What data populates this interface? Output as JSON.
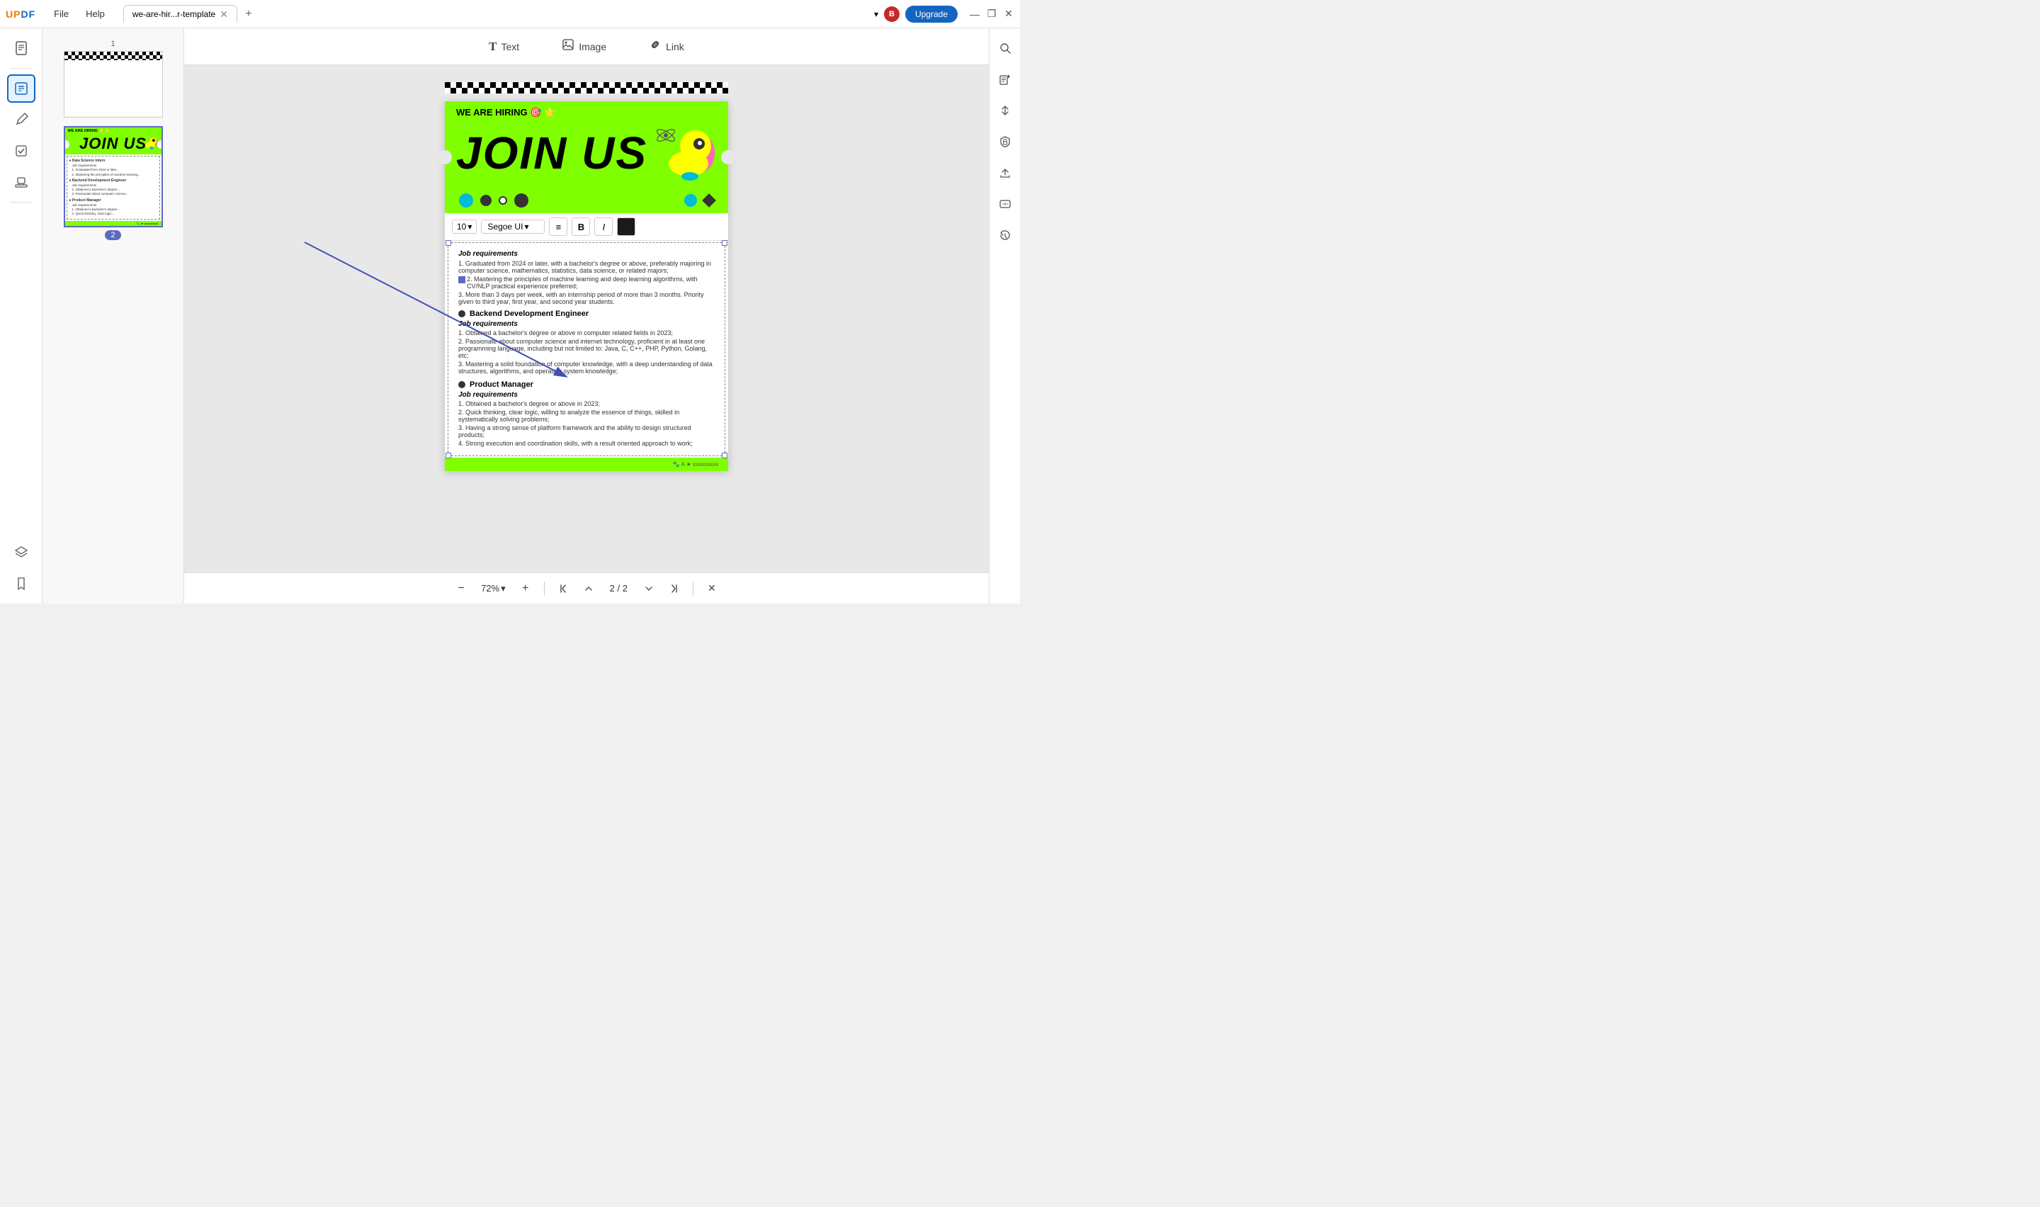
{
  "app": {
    "logo": "UPDF",
    "logo_color_u": "#f57c00",
    "logo_color_pdf": "#1565c0"
  },
  "title_bar": {
    "menu_items": [
      "File",
      "Help"
    ],
    "tab_title": "we-are-hir...r-template",
    "tab_add_label": "+",
    "upgrade_label": "Upgrade",
    "user_initial": "B",
    "win_minimize": "—",
    "win_maximize": "❐",
    "win_close": "✕",
    "dropdown_icon": "▾"
  },
  "left_sidebar": {
    "icons": [
      {
        "name": "document-icon",
        "symbol": "📄"
      },
      {
        "name": "divider-top",
        "type": "divider"
      },
      {
        "name": "edit-text-icon",
        "symbol": "T",
        "active": true
      },
      {
        "name": "annotation-icon",
        "symbol": "✏️"
      },
      {
        "name": "form-icon",
        "symbol": "☑"
      },
      {
        "name": "stamp-icon",
        "symbol": "⊕"
      },
      {
        "name": "layers-icon",
        "symbol": "◧"
      },
      {
        "name": "bookmark-icon",
        "symbol": "🔖"
      }
    ]
  },
  "toolbar": {
    "text_label": "Text",
    "image_label": "Image",
    "link_label": "Link",
    "text_icon": "T",
    "image_icon": "🖼",
    "link_icon": "🔗"
  },
  "format_bar": {
    "font_size": "10",
    "font_name": "Segoe UI",
    "align_icon": "≡",
    "bold_label": "B",
    "italic_label": "I",
    "color_label": "color",
    "more_label": "▼"
  },
  "document": {
    "page_num": "2",
    "total_pages": "2",
    "zoom": "72%",
    "hiring_header": "WE ARE HIRING 🎯 ⭐",
    "join_us": "JOIN US",
    "sections": [
      {
        "title": "Backend Development Engineer",
        "req_title": "Job requirements",
        "items": [
          "1. Obtained a bachelor's degree or above in computer related fields in 2023;",
          "2. Passionate about computer science and internet technology, proficient in at least one programming language, including but not limited to: Java, C, C++, PHP, Python, Golang, etc;",
          "3. Mastering a solid foundation of computer knowledge, with a deep understanding of data structures, algorithms, and operating system knowledge;"
        ]
      },
      {
        "title": "Product Manager",
        "req_title": "Job requirements",
        "items": [
          "1. Obtained a bachelor's degree or above in 2023;",
          "2. Quick thinking, clear logic, willing to analyze the essence of things, skilled in systematically solving problems;",
          "3. Having a strong sense of platform framework and the ability to design structured products;",
          "4. Strong execution and coordination skills, with a result oriented approach to work;"
        ]
      }
    ],
    "prev_section": {
      "req_title": "Job requirements",
      "items": [
        "1. Graduated from 2024 or later, with a bachelor's degree or above, preferably majoring in computer science, mathematics, statistics, data science, or related majors;",
        "2. Mastering the principles of machine learning and deep learning algorithms, with CV/NLP practical experience preferred;",
        "3. More than 3 days per week, with an internship period of more than 3 months. Priority given to third year, first year, and second year students."
      ]
    },
    "footer_text": "🐾 A ★ xxxxxxxxx"
  },
  "thumbnail": {
    "page1_label": "1",
    "page2_label": "2",
    "page2_hiring": "WE ARE HIRING ⭐ ⭐",
    "page2_join": "JOIN US"
  },
  "bottom_bar": {
    "zoom_out": "−",
    "zoom_in": "+",
    "zoom_value": "72%",
    "zoom_dropdown": "▾",
    "first_page": "⏮",
    "prev_page": "▲",
    "next_page": "▼",
    "last_page": "⏭",
    "page_info": "2 / 2",
    "close": "✕"
  },
  "right_sidebar": {
    "icons": [
      {
        "name": "search-icon",
        "symbol": "🔍"
      },
      {
        "name": "ocr-icon",
        "symbol": "📝"
      },
      {
        "name": "pdf-convert-icon",
        "symbol": "↕"
      },
      {
        "name": "protect-icon",
        "symbol": "🔒"
      },
      {
        "name": "share-icon",
        "symbol": "↗"
      },
      {
        "name": "sign-icon",
        "symbol": "✉"
      },
      {
        "name": "history-icon",
        "symbol": "⟳"
      }
    ]
  }
}
